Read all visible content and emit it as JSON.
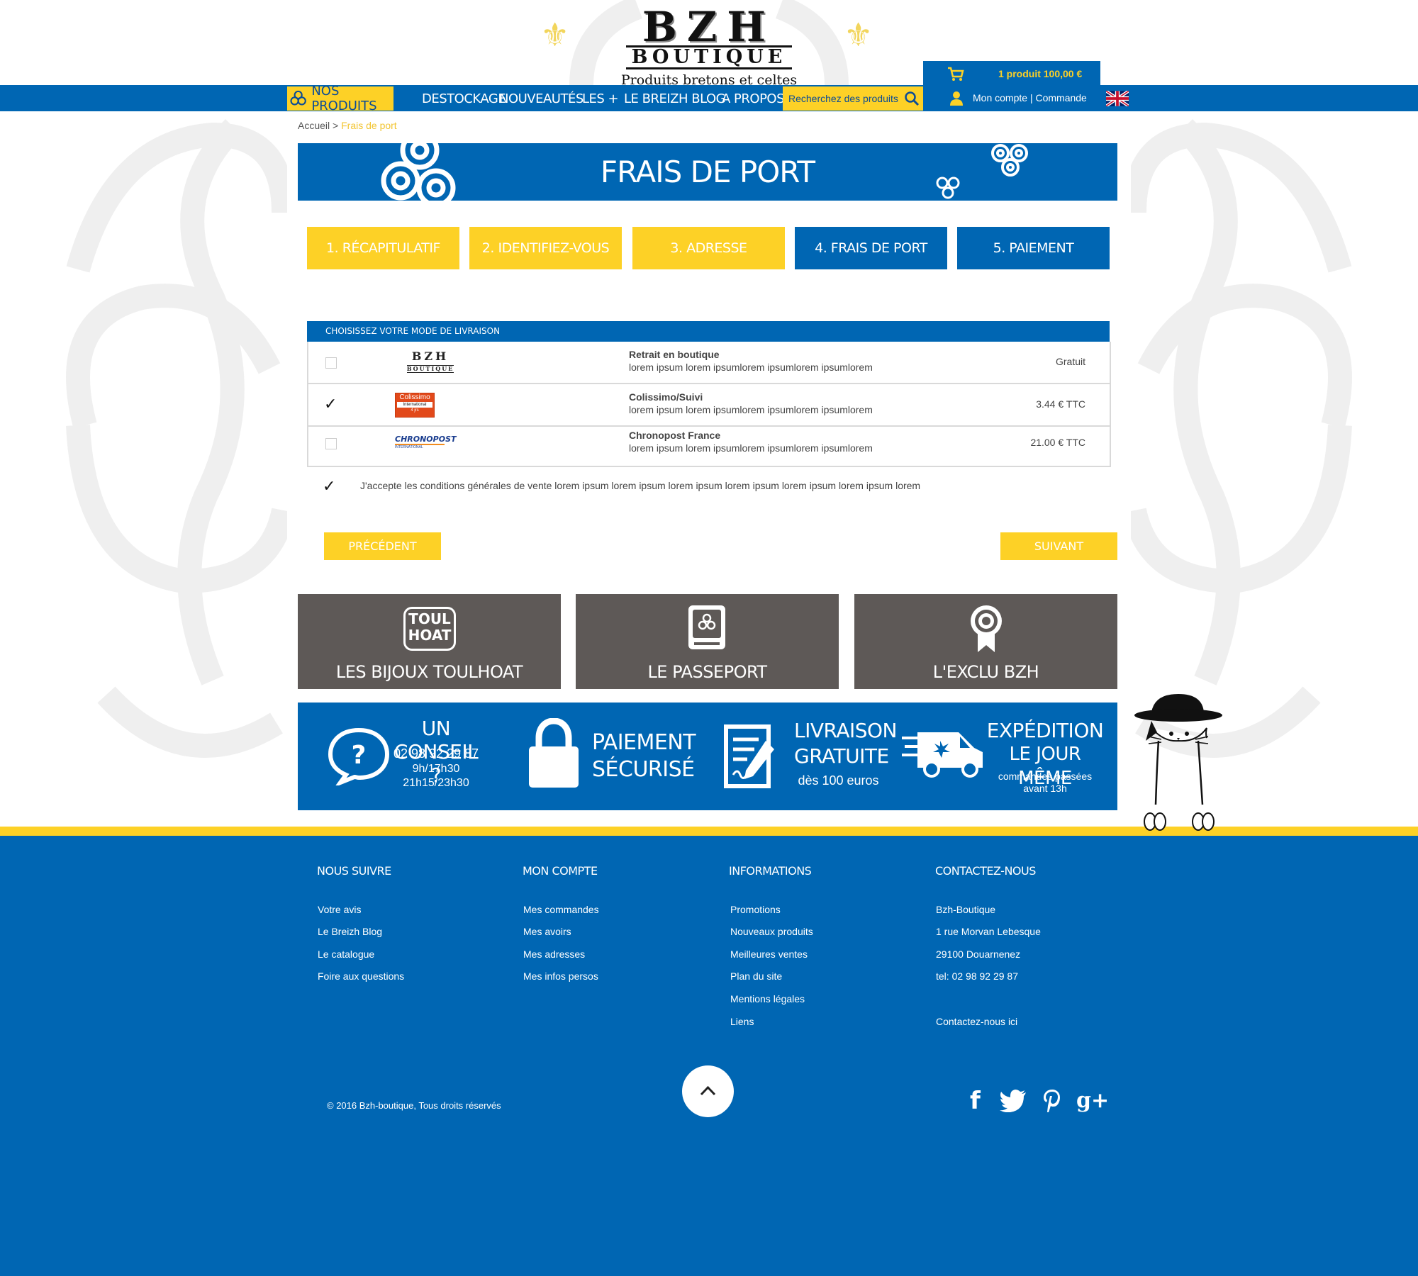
{
  "header": {
    "logo_main": "BZH",
    "logo_sub": "BOUTIQUE",
    "logo_tagline": "Produits bretons et celtes",
    "cart_summary": "1 produit 100,00 €",
    "account_link": "Mon compte",
    "separator": "|",
    "order_link": "Commande"
  },
  "nav": {
    "products": "NOS PRODUITS",
    "items": [
      "DESTOCKAGE",
      "NOUVEAUTÉS",
      "LES +",
      "LE BREIZH BLOG",
      "A PROPOS"
    ],
    "search_placeholder": "Recherchez des produits"
  },
  "breadcrumb": {
    "home": "Accueil",
    "separator": ">",
    "current": "Frais de port"
  },
  "page_title": "FRAIS DE PORT",
  "steps": [
    {
      "label": "1. RÉCAPITULATIF",
      "state": "done"
    },
    {
      "label": "2. IDENTIFIEZ-VOUS",
      "state": "done"
    },
    {
      "label": "3. ADRESSE",
      "state": "done"
    },
    {
      "label": "4. FRAIS DE PORT",
      "state": "current"
    },
    {
      "label": "5. PAIEMENT",
      "state": "todo"
    }
  ],
  "delivery": {
    "header": "CHOISISSEZ VOTRE MODE DE LIVRAISON",
    "options": [
      {
        "logo_text_1": "BZH",
        "logo_text_2": "BOUTIQUE",
        "name": "Retrait en boutique",
        "desc": "lorem ipsum lorem ipsumlorem ipsumlorem ipsumlorem",
        "price": "Gratuit",
        "selected": false
      },
      {
        "logo_text_1": "Colissimo",
        "logo_text_2": "International",
        "logo_text_3": "4 jrs",
        "name": "Colissimo/Suivi",
        "desc": "lorem ipsum lorem ipsumlorem ipsumlorem ipsumlorem",
        "price": "3.44 € TTC",
        "selected": true
      },
      {
        "logo_text_1": "CHRONOPOST",
        "logo_text_2": "INTERNATIONAL",
        "name": "Chronopost France",
        "desc": "lorem ipsum lorem ipsumlorem ipsumlorem ipsumlorem",
        "price": "21.00 € TTC",
        "selected": false
      }
    ],
    "cgv_text": "J'accepte les conditions générales de vente lorem ipsum  lorem ipsum lorem ipsum lorem ipsum lorem ipsum lorem ipsum lorem",
    "cgv_checked": true
  },
  "buttons": {
    "previous": "PRÉCÉDENT",
    "next": "SUIVANT"
  },
  "feature_cards": [
    {
      "icon": "toulhoat-logo",
      "icon_text_1": "TOUL",
      "icon_text_2": "HOAT",
      "label": "LES BIJOUX TOULHOAT"
    },
    {
      "icon": "passport-icon",
      "label": "LE PASSEPORT"
    },
    {
      "icon": "award-ribbon-icon",
      "label": "L'EXCLU BZH"
    }
  ],
  "reassurance": {
    "advice_title": "UN CONSEIL ?",
    "advice_phone": "02 98 92 29 87",
    "advice_hours_1": "9h/17h30",
    "advice_hours_2": "21h15/23h30",
    "payment_line_1": "PAIEMENT",
    "payment_line_2": "SÉCURISÉ",
    "delivery_line_1": "LIVRAISON",
    "delivery_line_2": "GRATUITE",
    "delivery_note": "dès 100 euros",
    "shipping_line_1": "EXPÉDITION",
    "shipping_line_2": "LE JOUR MÊME",
    "shipping_note_1": "commandes passées",
    "shipping_note_2": "avant 13h"
  },
  "footer": {
    "columns": [
      {
        "title": "NOUS SUIVRE",
        "links": [
          "Votre avis",
          "Le Breizh Blog",
          "Le catalogue",
          "Foire aux questions"
        ]
      },
      {
        "title": "MON COMPTE",
        "links": [
          "Mes commandes",
          "Mes avoirs",
          "Mes adresses",
          "Mes infos persos"
        ]
      },
      {
        "title": "INFORMATIONS",
        "links": [
          "Promotions",
          "Nouveaux  produits",
          "Meilleures ventes",
          "Plan du site",
          "Mentions légales",
          "Liens"
        ]
      },
      {
        "title": "CONTACTEZ-NOUS",
        "links": [
          "Bzh-Boutique",
          "1 rue Morvan Lebesque",
          "29100 Douarnenez",
          "tel: 02 98 92 29 87"
        ],
        "extra": "Contactez-nous ici"
      }
    ],
    "copyright": "© 2016  Bzh-boutique, Tous droits réservés",
    "social": [
      "facebook-icon",
      "twitter-icon",
      "pinterest-icon",
      "google-plus-icon"
    ],
    "social_glyphs": [
      "f",
      "g+"
    ]
  },
  "colors": {
    "brand_blue": "#0066b3",
    "brand_yellow": "#fdd126",
    "card_grey": "#5e5957"
  }
}
